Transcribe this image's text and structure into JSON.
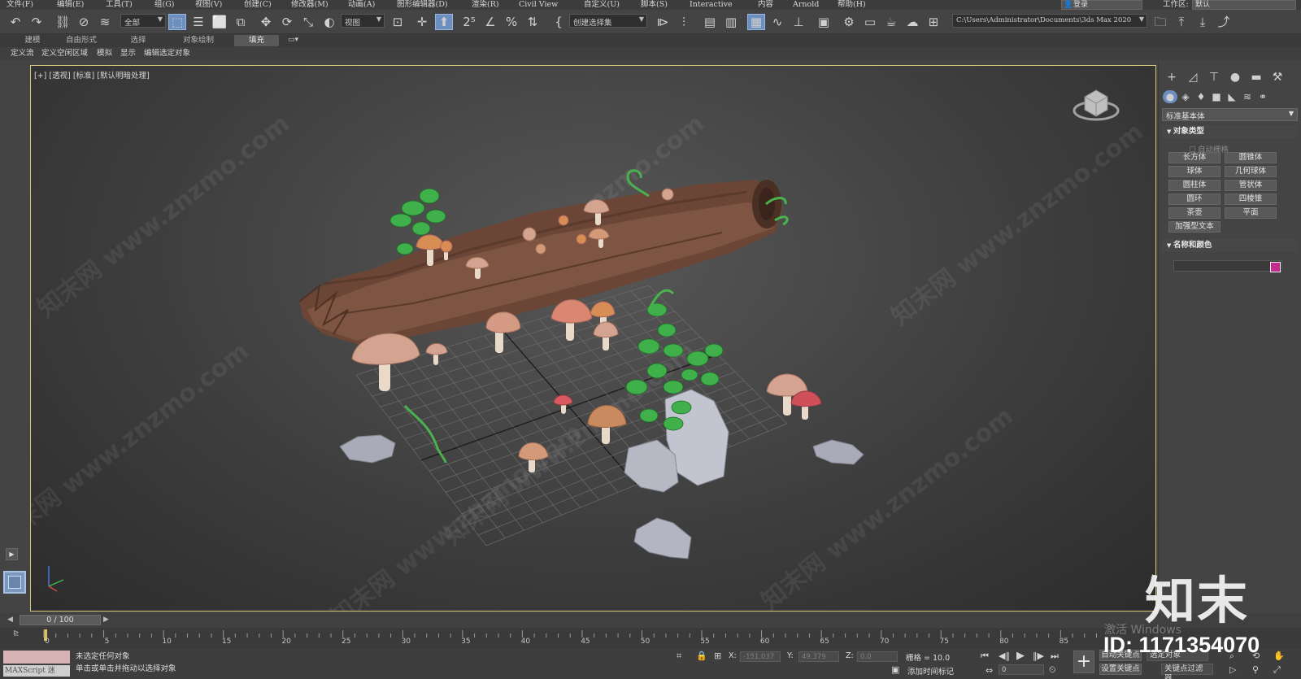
{
  "menubar": {
    "items": [
      "文件(F)",
      "编辑(E)",
      "工具(T)",
      "组(G)",
      "视图(V)",
      "创建(C)",
      "修改器(M)",
      "动画(A)",
      "图形编辑器(D)",
      "渲染(R)",
      "Civil View",
      "自定义(U)",
      "脚本(S)",
      "Interactive",
      "内容",
      "Arnold"
    ],
    "help": "帮助(H)",
    "login": "登录",
    "workspace_label": "工作区:",
    "workspace_value": "默认"
  },
  "toolbar": {
    "selection_filter": "全部",
    "reference_coord": "视图",
    "named_selection": "创建选择集",
    "project_path": "C:\\Users\\Administrator\\Documents\\3ds Max 2020"
  },
  "ribbon": {
    "tabs": [
      "建模",
      "自由形式",
      "选择",
      "对象绘制",
      "填充"
    ],
    "subitems": [
      "定义流",
      "定义空闲区域",
      "模拟",
      "显示",
      "编辑选定对象"
    ]
  },
  "viewport": {
    "label": "[+] [透视] [标准] [默认明暗处理]",
    "watermark": "知末网 www.znzmo.com"
  },
  "command_panel": {
    "dropdown": "标准基本体",
    "object_type_title": "对象类型",
    "autogrid": "自动栅格",
    "buttons": [
      [
        "长方体",
        "圆锥体"
      ],
      [
        "球体",
        "几何球体"
      ],
      [
        "圆柱体",
        "管状体"
      ],
      [
        "圆环",
        "四棱锥"
      ],
      [
        "茶壶",
        "平面"
      ],
      [
        "加强型文本"
      ]
    ],
    "name_color_title": "名称和颜色",
    "object_color": "#c42d8c"
  },
  "timeline": {
    "current": "0 / 100",
    "ticks": [
      "0",
      "5",
      "10",
      "15",
      "20",
      "25",
      "30",
      "35",
      "40",
      "45",
      "50",
      "55",
      "60",
      "65",
      "70",
      "75",
      "80",
      "85"
    ]
  },
  "status": {
    "maxscript": "MAXScript 迷",
    "line1": "未选定任何对象",
    "line2": "单击或单击并拖动以选择对象",
    "x_label": "X:",
    "x_value": "-151.037",
    "y_label": "Y:",
    "y_value": "49.379",
    "z_label": "Z:",
    "z_value": "0.0",
    "grid": "栅格 = 10.0",
    "add_time_tag": "添加时间标记",
    "auto_key": "自动关键点",
    "set_key": "设置关键点",
    "selected_obj": "选定对象",
    "key_filter": "关键点过滤器...",
    "frame": "0"
  },
  "overlay": {
    "brand": "知末",
    "windows_activate": "激活 Windows",
    "id": "ID: 1171354070"
  }
}
